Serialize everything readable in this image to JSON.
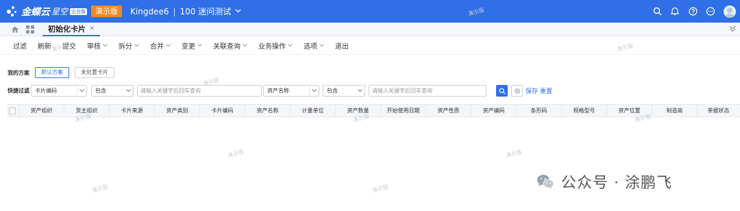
{
  "topbar": {
    "logo_text": "金蝶云",
    "logo_sub": "星空",
    "logo_badge": "企业版",
    "demo_badge": "演示版",
    "user": "Kingdee6",
    "separator": "|",
    "tenant": "100 迷问测试",
    "brand_color": "#2f6fe8",
    "demo_color": "#f08a24",
    "icons": [
      "search-icon",
      "bell-icon",
      "help-icon",
      "message-icon",
      "avatar"
    ]
  },
  "tabs": {
    "active_label": "初始化卡片",
    "close": "×"
  },
  "toolbar": {
    "items": [
      {
        "label": "过滤",
        "dropdown": false
      },
      {
        "label": "刷新",
        "dropdown": false
      },
      {
        "label": "提交",
        "dropdown": false
      },
      {
        "label": "审核",
        "dropdown": true
      },
      {
        "label": "拆分",
        "dropdown": true
      },
      {
        "label": "合并",
        "dropdown": true
      },
      {
        "label": "变更",
        "dropdown": true
      },
      {
        "label": "关联查询",
        "dropdown": true
      },
      {
        "label": "业务操作",
        "dropdown": true
      },
      {
        "label": "选项",
        "dropdown": true
      },
      {
        "label": "退出",
        "dropdown": false
      }
    ]
  },
  "scheme": {
    "label": "我的方案",
    "default": "默认方案",
    "unprocessed": "未处置卡片"
  },
  "quick_filter": {
    "label": "快捷过滤",
    "field1": "卡片编码",
    "op1": "包含",
    "placeholder1": "请输入关键字后回车查询",
    "field2": "资产名称",
    "op2": "包含",
    "placeholder2": "请输入关键字后回车查询",
    "save": "保存",
    "reset": "重置"
  },
  "grid": {
    "columns": [
      "资产组织",
      "货主组织",
      "卡片来源",
      "资产类别",
      "卡片编码",
      "资产名称",
      "计量单位",
      "资产数量",
      "开始使用日期",
      "资产性质",
      "资产编码",
      "条形码",
      "规格型号",
      "资产位置",
      "制造商",
      "单据状态"
    ]
  },
  "watermark": "演示版",
  "footer": {
    "text": "公众号 · 涂鹏飞"
  }
}
